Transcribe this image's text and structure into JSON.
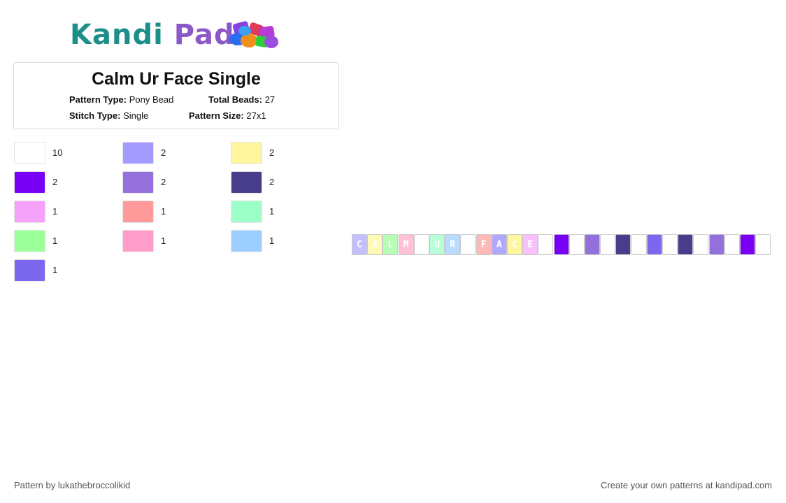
{
  "logo": {
    "part1": "Kandi",
    "part2": " Pad"
  },
  "pattern": {
    "title": "Calm Ur Face Single",
    "type_label": "Pattern Type:",
    "type_value": "Pony Bead",
    "beads_label": "Total Beads:",
    "beads_value": "27",
    "stitch_label": "Stitch Type:",
    "stitch_value": "Single",
    "size_label": "Pattern Size:",
    "size_value": "27x1"
  },
  "palette": [
    {
      "color": "#ffffff",
      "count": "10"
    },
    {
      "color": "#a39bff",
      "count": "2"
    },
    {
      "color": "#fff59e",
      "count": "2"
    },
    {
      "color": "#7800f5",
      "count": "2"
    },
    {
      "color": "#9370db",
      "count": "2"
    },
    {
      "color": "#483d8b",
      "count": "2"
    },
    {
      "color": "#f5a3fa",
      "count": "1"
    },
    {
      "color": "#ff9a9a",
      "count": "1"
    },
    {
      "color": "#9cffc8",
      "count": "1"
    },
    {
      "color": "#9cff99",
      "count": "1"
    },
    {
      "color": "#ff9cc8",
      "count": "1"
    },
    {
      "color": "#9ccfff",
      "count": "1"
    },
    {
      "color": "#7b68ee",
      "count": "1"
    }
  ],
  "beads": [
    {
      "color": "#c4c0ff",
      "letter": "C"
    },
    {
      "color": "#fffab8",
      "letter": "A"
    },
    {
      "color": "#b8ffb6",
      "letter": "L"
    },
    {
      "color": "#ffc0d8",
      "letter": "M"
    },
    {
      "color": "#ffffff",
      "letter": ""
    },
    {
      "color": "#b8ffd8",
      "letter": "U"
    },
    {
      "color": "#b8dcff",
      "letter": "R"
    },
    {
      "color": "#ffffff",
      "letter": ""
    },
    {
      "color": "#ffb8b8",
      "letter": "F"
    },
    {
      "color": "#b0a8ff",
      "letter": "A"
    },
    {
      "color": "#fff6a0",
      "letter": "C"
    },
    {
      "color": "#f8c0fc",
      "letter": "E"
    },
    {
      "color": "#ffffff",
      "letter": ""
    },
    {
      "color": "#7800f5",
      "letter": ""
    },
    {
      "color": "#ffffff",
      "letter": ""
    },
    {
      "color": "#9370db",
      "letter": ""
    },
    {
      "color": "#ffffff",
      "letter": ""
    },
    {
      "color": "#483d8b",
      "letter": ""
    },
    {
      "color": "#ffffff",
      "letter": ""
    },
    {
      "color": "#7b68ee",
      "letter": ""
    },
    {
      "color": "#ffffff",
      "letter": ""
    },
    {
      "color": "#483d8b",
      "letter": ""
    },
    {
      "color": "#ffffff",
      "letter": ""
    },
    {
      "color": "#9370db",
      "letter": ""
    },
    {
      "color": "#ffffff",
      "letter": ""
    },
    {
      "color": "#7800f5",
      "letter": ""
    },
    {
      "color": "#ffffff",
      "letter": ""
    }
  ],
  "footer": {
    "left": "Pattern by lukathebroccolikid",
    "right": "Create your own patterns at kandipad.com"
  }
}
